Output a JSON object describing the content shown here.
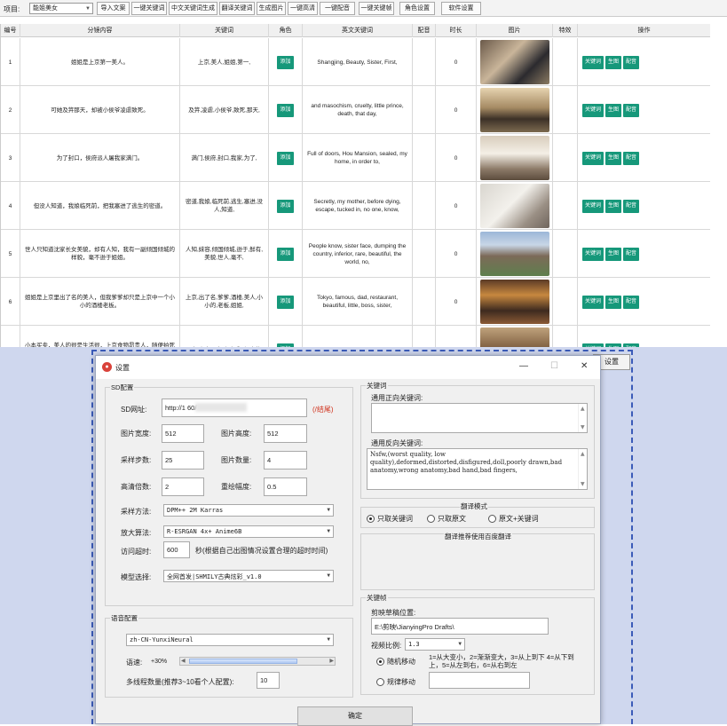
{
  "toolbar": {
    "project_label": "项目:",
    "project_value": "能姐美女",
    "buttons": [
      "导入文案",
      "一键关键词",
      "中文关键词生成",
      "翻译关键词",
      "生成图片",
      "一键高清",
      "一键配音",
      "一键关键帧",
      "角色设置",
      "软件设置"
    ]
  },
  "table": {
    "headers": [
      "编号",
      "分镜内容",
      "关键词",
      "角色",
      "英文关键词",
      "配音",
      "时长",
      "图片",
      "特效",
      "操作"
    ],
    "rows": [
      {
        "id": "1",
        "content": "姐姐是上京第一美人。",
        "keywords": "上京,美人,姐姐,第一,",
        "role_btn": "添加",
        "english": "Shangjing, Beauty, Sister, First,",
        "duration": "0"
      },
      {
        "id": "2",
        "content": "可她及笄那天，却被小侯爷凌虐致死。",
        "keywords": "及笄,凌虐,小侯爷,致死,那天,",
        "role_btn": "添加",
        "english": "and masochism, cruelty, little prince, death, that day,",
        "duration": "0"
      },
      {
        "id": "3",
        "content": "为了封口，侯府派人屠我家满门。",
        "keywords": "满门,侯府,封口,我家,为了,",
        "role_btn": "添加",
        "english": "Full of doors, Hou Mansion, sealed, my home, in order to,",
        "duration": "0"
      },
      {
        "id": "4",
        "content": "但没人知道，我娘临死前，把我塞进了逃生的密道。",
        "keywords": "密道,我娘,临死前,逃生,塞进,没人,知道,",
        "role_btn": "添加",
        "english": "Secretly, my mother, before dying, escape, tucked in, no one, know,",
        "duration": "0"
      },
      {
        "id": "5",
        "content": "世人只知道沈家长女美貌，却有人知，我有一副倾国倾城的样貌，毫不逊于姐姐。",
        "keywords": "人知,妹容,倾国倾城,逊于,鲜有,美貌,世人,毫不,",
        "role_btn": "添加",
        "english": "People know, sister face, dumping the country, inferior, rare, beautiful, the world, no,",
        "duration": "0"
      },
      {
        "id": "6",
        "content": "姐姐是上京里出了名的美人，但我爹爹却只是上京中一个小小的酒楼老板。",
        "keywords": "上京,出了名,爹爹,酒楼,美人,小小的,老板,姐姐,",
        "role_btn": "添加",
        "english": "Tokyo, famous, dad, restaurant, beautiful, little, boss, sister,",
        "duration": "0"
      },
      {
        "id": "7",
        "content": "小本买卖，美人的很是生活很，上京食物昂贵人，随便拍死了",
        "keywords": "买卖,小本买卖,上京,和店,食物,",
        "role_btn": "添加",
        "english": "I can't afford it, Shinong industry and",
        "duration": ""
      }
    ],
    "action_buttons": [
      "关键词",
      "生图",
      "配音"
    ]
  },
  "background_button": "设置",
  "dialog": {
    "title": "设置",
    "sd": {
      "group_title": "SD配置",
      "url_label": "SD网址:",
      "url_value": "http://1            60/",
      "url_link": "(/结尾)",
      "width_label": "图片宽度:",
      "width_value": "512",
      "height_label": "图片高度:",
      "height_value": "512",
      "steps_label": "采样步数:",
      "steps_value": "25",
      "count_label": "图片数量:",
      "count_value": "4",
      "upscale_label": "高清倍数:",
      "upscale_value": "2",
      "redraw_label": "重绘幅度:",
      "redraw_value": "0.5",
      "sampler_label": "采样方法:",
      "sampler_value": "DPM++ 2M Karras",
      "upscaler_label": "放大算法:",
      "upscaler_value": "R-ESRGAN 4x+ Anime6B",
      "timeout_label": "访问超时:",
      "timeout_value": "600",
      "timeout_hint": "秒(根据自己出图情况设置合理的超时时间)",
      "model_label": "模型选择:",
      "model_value": "全网首发|SHMILY古典炫彩_v1.0"
    },
    "voice": {
      "group_title": "语音配置",
      "voice_value": "zh-CN-YunxiNeural",
      "speed_label": "语速:",
      "speed_value": "+30%",
      "speed_fraction": 0.8,
      "threads_label": "多线程数量(推荐3~10看个人配置):",
      "threads_value": "10"
    },
    "keywords": {
      "group_title": "关键词",
      "positive_label": "通用正向关键词:",
      "positive_value": "",
      "negative_label": "通用反向关键词:",
      "negative_value": "Nsfw,(worst quality, low quality),deformed,distorted,disfigured,doll,poorly drawn,bad anatomy,wrong anatomy,bad hand,bad fingers,"
    },
    "mode": {
      "group_title": "翻译模式",
      "options": [
        "只取关键词",
        "只取原文",
        "原文+关键词"
      ],
      "selected": 0,
      "recommend_text": "翻译推荐使用百度翻译"
    },
    "keyframe": {
      "group_title": "关键帧",
      "drafts_label": "剪映草稿位置:",
      "drafts_value": "E:\\剪映\\JianyingPro Drafts\\",
      "ratio_label": "视频比例:",
      "ratio_value": "1.3",
      "random_label": "随机移动",
      "random_hint": "1=从大变小，2=渐渐变大，3=从上到下 4=从下到上，5=从左到右，6=从右到左",
      "rule_label": "规律移动",
      "rule_value": ""
    },
    "ok_button": "确定"
  }
}
